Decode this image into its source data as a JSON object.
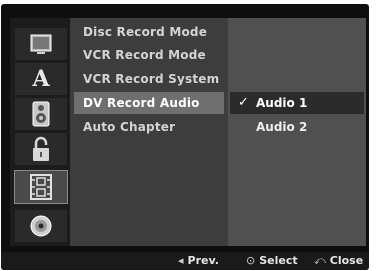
{
  "settings_menu": {
    "items": [
      {
        "label": "Disc Record Mode"
      },
      {
        "label": "VCR Record Mode"
      },
      {
        "label": "VCR Record System"
      },
      {
        "label": "DV Record Audio"
      },
      {
        "label": "Auto Chapter"
      }
    ],
    "active_index": 3
  },
  "submenu": {
    "options": [
      {
        "label": "Audio 1",
        "checked": true
      },
      {
        "label": "Audio 2",
        "checked": false
      }
    ],
    "check_glyph": "✓"
  },
  "sidebar": {
    "icons": [
      {
        "name": "display-icon"
      },
      {
        "name": "language-icon",
        "glyph": "A"
      },
      {
        "name": "speaker-icon"
      },
      {
        "name": "lock-icon"
      },
      {
        "name": "film-icon",
        "selected": true
      },
      {
        "name": "disc-icon"
      }
    ]
  },
  "footer": {
    "prev": {
      "glyph": "◂",
      "label": "Prev."
    },
    "select": {
      "glyph": "⊙",
      "label": "Select"
    },
    "close": {
      "glyph": "⤺",
      "label": "Close"
    }
  },
  "colors": {
    "menu_bg": "#3d3d3d",
    "menu_highlight": "#6f6f6f",
    "submenu_bg": "#505050",
    "submenu_highlight": "#2b2b2b",
    "footer_bg": "#1a1a1a"
  }
}
